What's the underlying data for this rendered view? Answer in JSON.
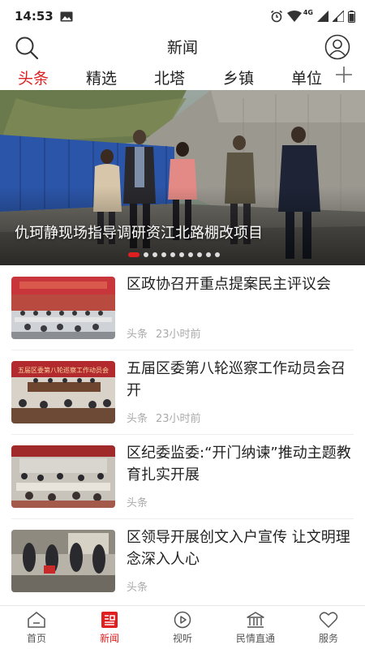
{
  "status_bar": {
    "time": "14:53",
    "network": "4G"
  },
  "header": {
    "title": "新闻"
  },
  "tabs": [
    {
      "label": "头条",
      "active": true
    },
    {
      "label": "精选"
    },
    {
      "label": "北塔"
    },
    {
      "label": "乡镇"
    },
    {
      "label": "单位"
    }
  ],
  "hero": {
    "caption": "仇珂静现场指导调研资江北路棚改项目",
    "slide_count": 10,
    "active_slide": 1
  },
  "news": [
    {
      "title": "区政协召开重点提案民主评议会",
      "source": "头条",
      "time": "23小时前"
    },
    {
      "title": "五届区委第八轮巡察工作动员会召开",
      "source": "头条",
      "time": "23小时前"
    },
    {
      "title": "区纪委监委:“开门纳谏”推动主题教育扎实开展",
      "source": "头条",
      "time": ""
    },
    {
      "title": "区领导开展创文入户宣传 让文明理念深入人心",
      "source": "头条",
      "time": ""
    }
  ],
  "thumb_banners": {
    "item2": "五届区委第八轮巡察工作动员会"
  },
  "bottom_nav": [
    {
      "label": "首页",
      "icon": "home-icon"
    },
    {
      "label": "新闻",
      "icon": "news-icon",
      "active": true
    },
    {
      "label": "视听",
      "icon": "play-icon"
    },
    {
      "label": "民情直通",
      "icon": "building-icon"
    },
    {
      "label": "服务",
      "icon": "heart-icon"
    }
  ],
  "colors": {
    "accent": "#e02020",
    "text": "#222222",
    "meta": "#aaaaaa"
  }
}
